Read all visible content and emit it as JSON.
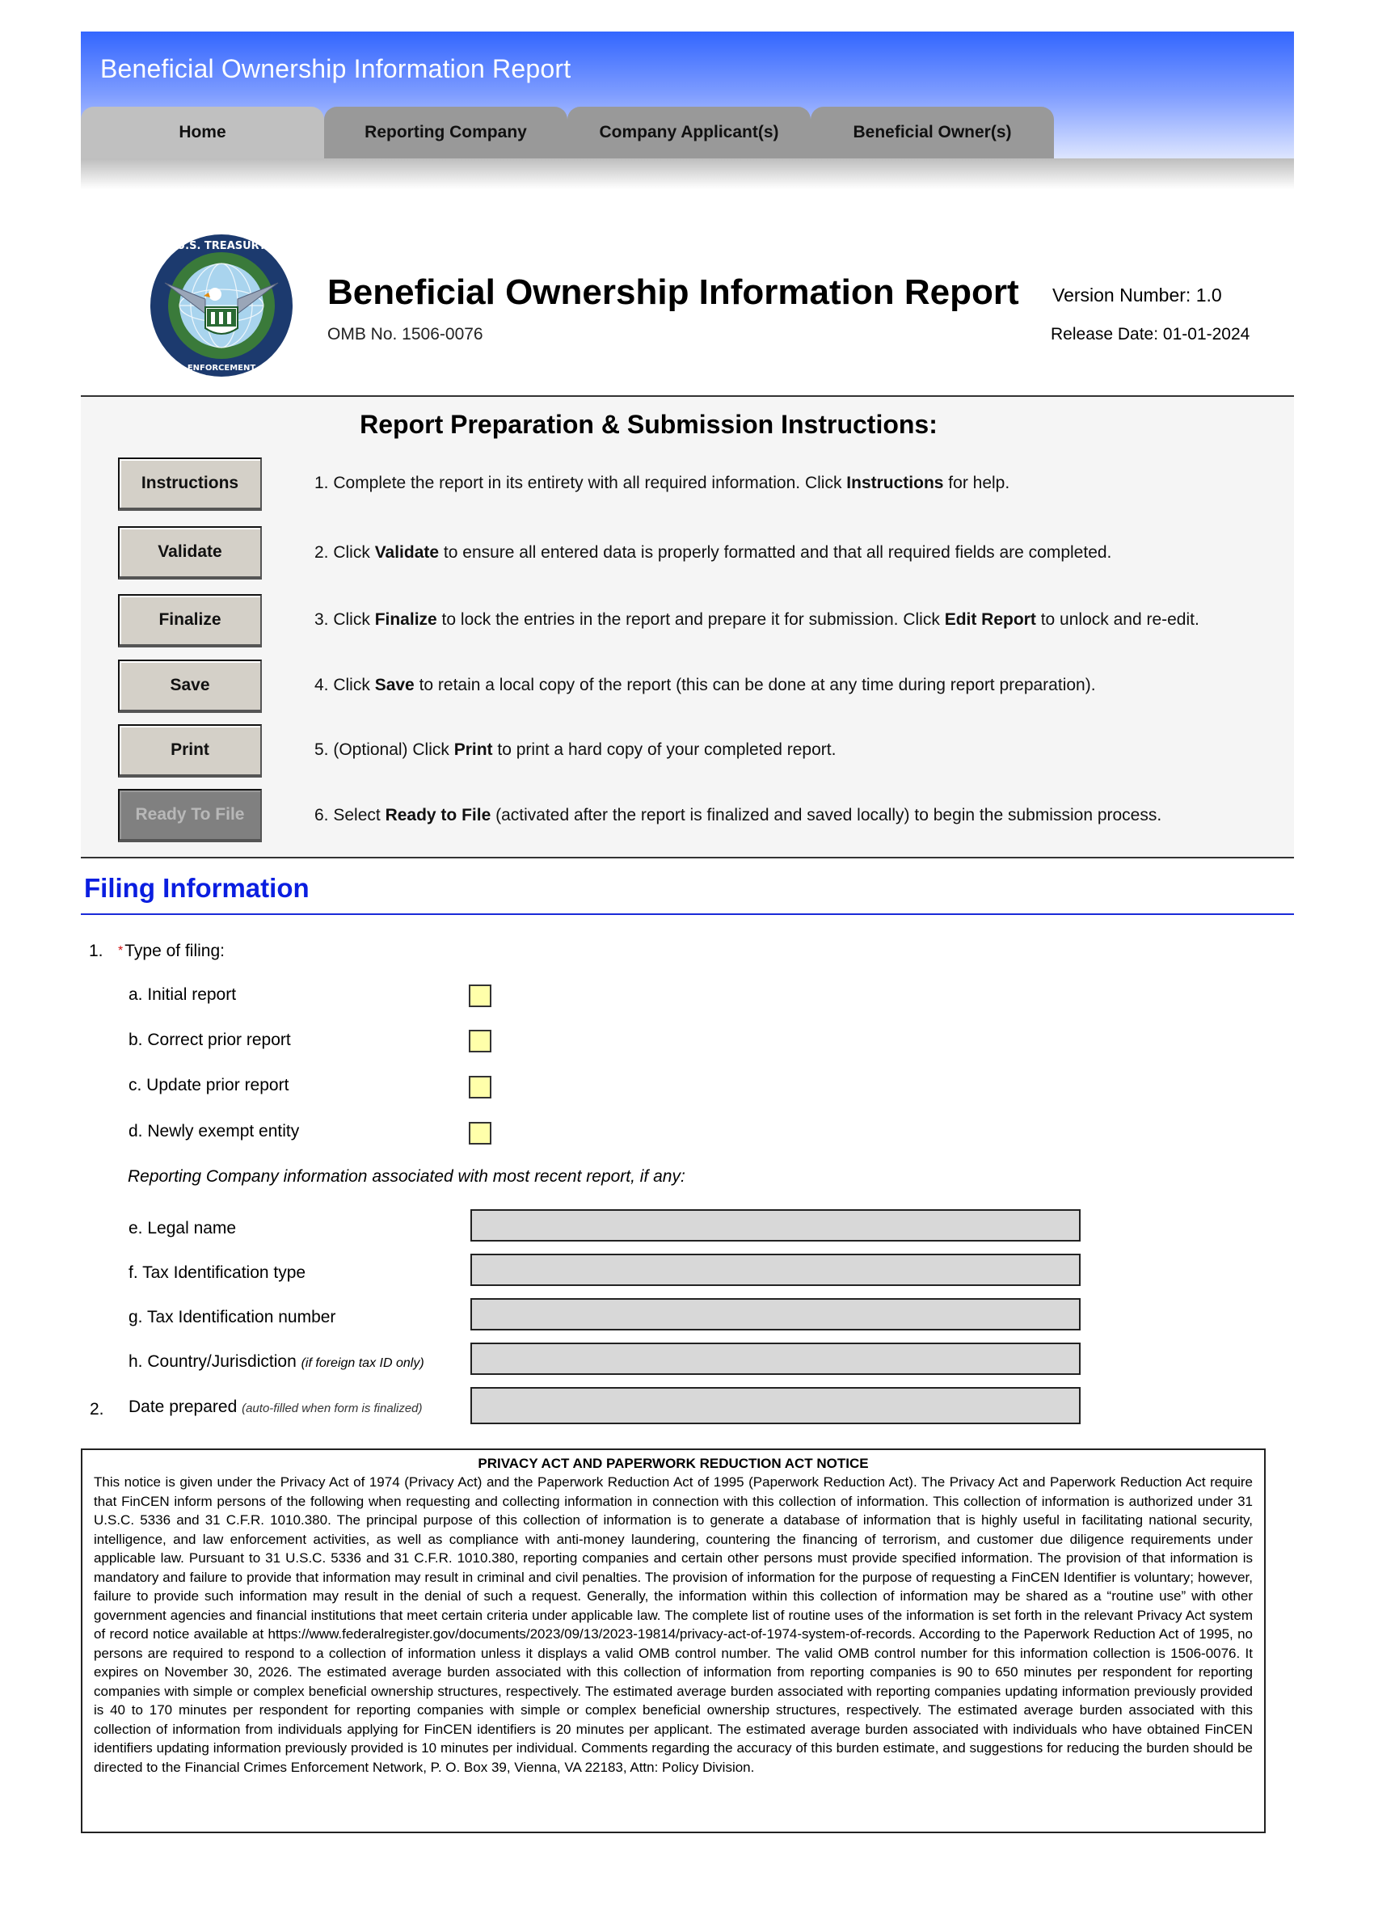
{
  "banner": {
    "title": "Beneficial Ownership Information Report",
    "tabs": [
      {
        "label": "Home",
        "active": true
      },
      {
        "label": "Reporting Company",
        "active": false
      },
      {
        "label": "Company Applicant(s)",
        "active": false
      },
      {
        "label": "Beneficial Owner(s)",
        "active": false
      }
    ]
  },
  "header": {
    "logo": "fincen-treasury-seal",
    "title": "Beneficial Ownership Information Report",
    "omb": "OMB No. 1506-0076",
    "version": "Version Number:  1.0",
    "release_date": "Release Date: 01-01-2024"
  },
  "instructions": {
    "title": "Report Preparation & Submission Instructions:",
    "steps": [
      {
        "button": "Instructions",
        "enabled": true,
        "pre": "1. Complete the report in its entirety with all required information. Click ",
        "bold": "Instructions",
        "mid": " for help.",
        "bold2": "",
        "post": ""
      },
      {
        "button": "Validate",
        "enabled": true,
        "pre": "2. Click ",
        "bold": "Validate",
        "mid": " to ensure all entered data is properly formatted and that all required fields are completed.",
        "bold2": "",
        "post": ""
      },
      {
        "button": "Finalize",
        "enabled": true,
        "pre": "3. Click ",
        "bold": "Finalize",
        "mid": " to lock the entries in the report and prepare it for submission. Click ",
        "bold2": "Edit Report",
        "post": " to unlock and re-edit."
      },
      {
        "button": "Save",
        "enabled": true,
        "pre": "4. Click ",
        "bold": "Save",
        "mid": " to retain a local copy of the report (this can be done at any time during report preparation).",
        "bold2": "",
        "post": ""
      },
      {
        "button": "Print",
        "enabled": true,
        "pre": "5. (Optional) Click ",
        "bold": "Print",
        "mid": " to print a hard copy of your completed report.",
        "bold2": "",
        "post": ""
      },
      {
        "button": "Ready To File",
        "enabled": false,
        "pre": "6. Select ",
        "bold": "Ready to File",
        "mid": " (activated after the report is finalized and saved locally) to begin the submission process.",
        "bold2": "",
        "post": ""
      }
    ]
  },
  "filing": {
    "title": "Filing Information",
    "q1": {
      "number": "1.",
      "required_mark": "*",
      "label": "Type of filing:",
      "options": [
        {
          "label": "a. Initial report",
          "checked": false
        },
        {
          "label": "b. Correct prior report",
          "checked": false
        },
        {
          "label": "c. Update prior report",
          "checked": false
        },
        {
          "label": "d. Newly exempt entity",
          "checked": false
        }
      ],
      "subheading": "Reporting Company information associated with most recent report, if any:",
      "fields": [
        {
          "label": "e. Legal name",
          "note": "",
          "value": ""
        },
        {
          "label": "f. Tax Identification type",
          "note": "",
          "value": ""
        },
        {
          "label": "g. Tax Identification number",
          "note": "",
          "value": ""
        },
        {
          "label": "h. Country/Jurisdiction ",
          "note": "(if foreign tax ID only)",
          "value": ""
        }
      ]
    },
    "q2": {
      "number": "2.",
      "label": "Date prepared ",
      "note": "(auto-filled when form is finalized)",
      "value": ""
    }
  },
  "notice": {
    "title": "PRIVACY ACT AND PAPERWORK REDUCTION ACT NOTICE",
    "body": "This notice is given under the Privacy Act of 1974 (Privacy Act) and the Paperwork Reduction Act of 1995 (Paperwork Reduction Act). The Privacy Act and Paperwork Reduction Act require that FinCEN inform persons of the following when requesting and collecting information in connection with this collection of information. This collection of information is authorized under 31 U.S.C. 5336 and 31 C.F.R. 1010.380. The principal purpose of this collection of information is to generate a database of information that is highly useful in facilitating national security, intelligence, and law enforcement activities, as well as compliance with anti-money laundering, countering the financing of terrorism, and customer due diligence requirements under applicable law. Pursuant to 31 U.S.C. 5336 and 31 C.F.R. 1010.380, reporting companies and certain other persons must provide specified information. The provision of that information is mandatory and failure to provide that information may result in criminal and civil penalties. The provision of information for the purpose of requesting a FinCEN Identifier is voluntary; however, failure to provide such information may result in the denial of such a request. Generally, the information within this collection of information may be shared as a “routine use” with other government agencies and financial institutions that meet certain criteria under applicable law. The complete list of routine uses of the information is set forth in the relevant Privacy Act system of record notice available at https://www.federalregister.gov/documents/2023/09/13/2023-19814/privacy-act-of-1974-system-of-records. According to the Paperwork Reduction Act of 1995, no persons are required to respond to a collection of information unless it displays a valid OMB control number. The valid OMB control number for this information collection is 1506-0076. It expires on November 30, 2026. The estimated average burden associated with this collection of information from reporting companies is 90 to 650 minutes per respondent for reporting companies with simple or complex beneficial ownership structures, respectively. The estimated average burden associated with reporting companies updating information previously provided is 40 to 170 minutes per respondent for reporting companies with simple or complex beneficial ownership structures, respectively. The estimated average burden associated with this collection of information from individuals applying for FinCEN identifiers is 20 minutes per applicant. The estimated average burden associated with individuals who have obtained FinCEN identifiers updating information previously provided is 10 minutes per individual. Comments regarding the accuracy of this burden estimate, and suggestions for reducing the burden should be directed to the Financial Crimes Enforcement Network, P. O. Box 39, Vienna, VA 22183, Attn: Policy Division."
  },
  "colors": {
    "banner_top": "#3366ff",
    "banner_bottom": "#dde5ff",
    "tab_active": "#c0c0c0",
    "tab_inactive": "#999999",
    "section_heading": "#0a1ee0",
    "checkbox_fill": "#ffffaa",
    "field_fill": "#d8d8d8",
    "required_mark": "#d01010"
  }
}
